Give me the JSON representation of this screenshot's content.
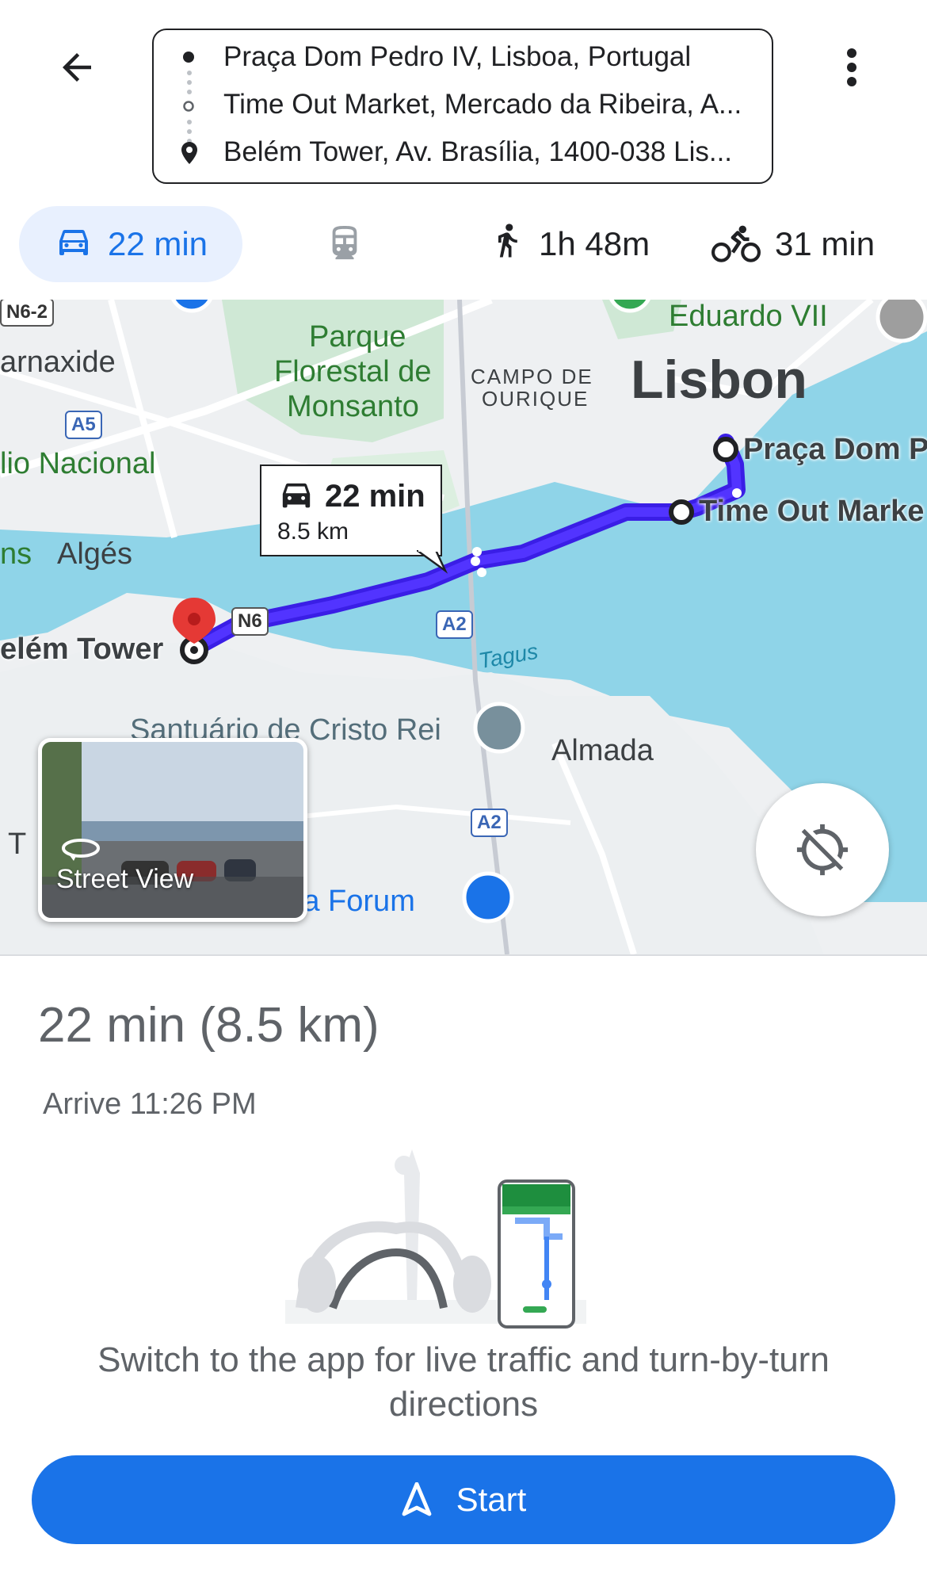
{
  "header": {
    "origin": "Praça Dom Pedro IV, Lisboa, Portugal",
    "waypoint": "Time Out Market, Mercado da Ribeira, A...",
    "destination": "Belém Tower, Av. Brasília, 1400-038 Lis..."
  },
  "modes": {
    "driving": "22 min",
    "walking": "1h 48m",
    "cycling": "31 min"
  },
  "map": {
    "labels": {
      "lisbon": "Lisbon",
      "parque": "Parque",
      "florestal": "Florestal de",
      "monsanto": "Monsanto",
      "campo": "CAMPO DE",
      "ourique": "OURIQUE",
      "eduardo": "Eduardo VII",
      "carnaxide": "arnaxide",
      "estadio": "lio Nacional",
      "alges": "Algés",
      "ns": "ns",
      "tagus": "Tagus",
      "santuario": "Santuário de Cristo Rei",
      "almada": "Almada",
      "almada_forum": "lmada Forum",
      "t_edge": "T",
      "praca_pin": "Praça Dom P",
      "timeout_pin": "Time Out Marke",
      "belem_pin": "elém Tower"
    },
    "shields": {
      "n6_2": "N6-2",
      "a5": "A5",
      "n6": "N6",
      "a2_top": "A2",
      "a2_bottom": "A2"
    },
    "callout": {
      "time": "22 min",
      "distance": "8.5 km"
    },
    "street_view_label": "Street View"
  },
  "summary": {
    "duration": "22 min (8.5 km)",
    "arrive": "Arrive 11:26 PM"
  },
  "promo": {
    "text_line1": "Switch to the app for live traffic and turn-by-turn",
    "text_line2": "directions"
  },
  "start_button": {
    "label": "Start"
  },
  "colors": {
    "accent": "#1a73e8",
    "route": "#3a1ee6",
    "water": "#8fd4e8",
    "park": "#c7ead1"
  }
}
